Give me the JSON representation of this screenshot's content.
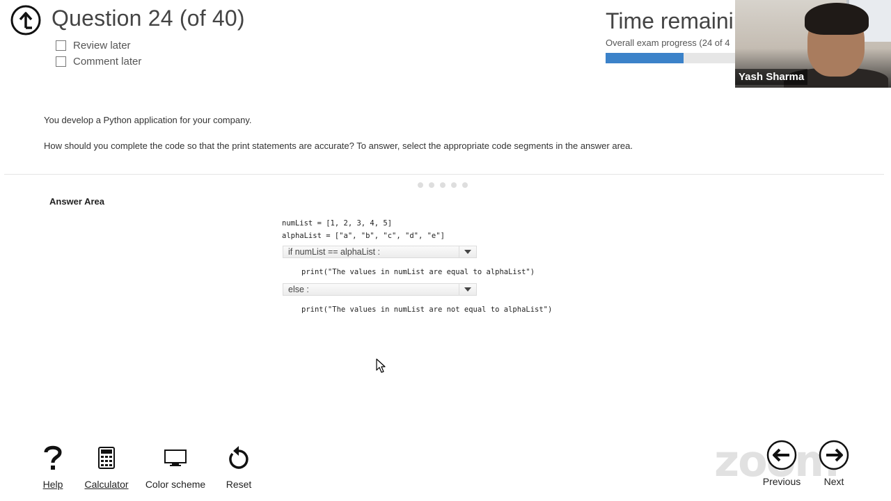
{
  "header": {
    "question_title": "Question 24 (of 40)",
    "review_later": "Review later",
    "comment_later": "Comment later",
    "time_title": "Time remainin",
    "progress_text": "Overall exam progress (24 of 4",
    "progress_fraction": 0.6
  },
  "video": {
    "participant_name": "Yash Sharma"
  },
  "question": {
    "line1": "You develop a Python application for your company.",
    "line2": "How should you complete the code so that the print statements are accurate? To answer, select the appropriate code segments in the answer area."
  },
  "answer_area": {
    "label": "Answer Area",
    "code_line1": "numList = [1, 2, 3, 4, 5]",
    "code_line2": "alphaList = [\"a\", \"b\", \"c\", \"d\", \"e\"]",
    "dropdown1_value": "if numList == alphaList :",
    "code_line3": "print(\"The values in numList are equal to alphaList\")",
    "dropdown2_value": "else :",
    "code_line4": "print(\"The values in numList are not equal to alphaList\")"
  },
  "toolbar": {
    "help": "Help",
    "calculator": "Calculator",
    "color_scheme": "Color scheme",
    "reset": "Reset"
  },
  "nav": {
    "watermark": "zoom",
    "previous": "Previous",
    "next": "Next"
  },
  "colors": {
    "progress": "#3b82c9",
    "text": "#333333"
  }
}
